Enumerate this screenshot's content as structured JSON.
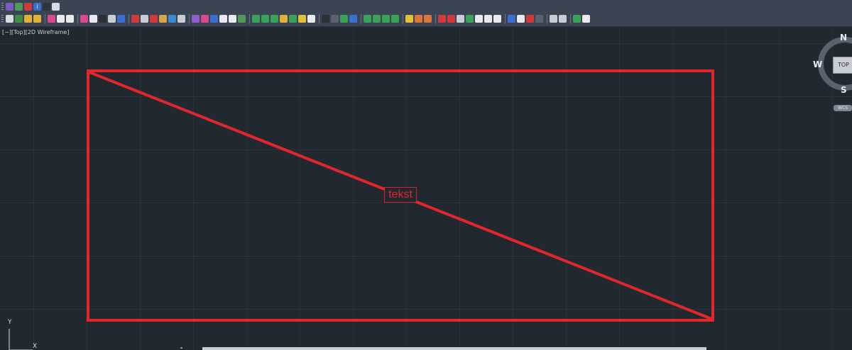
{
  "viewport": {
    "label": "[−][Top][2D Wireframe]",
    "drawing_color": "#e2262e",
    "text_object": "tekst"
  },
  "viewcube": {
    "north": "N",
    "west": "W",
    "south": "S",
    "face": "TOP",
    "wcs": "WCS"
  },
  "ucs": {
    "y": "Y",
    "x": "X"
  },
  "toolbar": {
    "row1": [
      {
        "name": "dimension-icon",
        "color": "#7c5cc4",
        "glyph": ""
      },
      {
        "name": "layer-image-icon",
        "color": "#4f9a5a",
        "glyph": ""
      },
      {
        "name": "shield-icon",
        "color": "#d03a3a",
        "glyph": ""
      },
      {
        "name": "info-icon",
        "color": "#3b6fd1",
        "glyph": "i"
      },
      {
        "name": "globe-icon",
        "color": "#2e3440",
        "glyph": ""
      },
      {
        "name": "edit-page-icon",
        "color": "#d7dbe2",
        "glyph": ""
      }
    ],
    "row2": [
      {
        "name": "layer-props-icon",
        "color": "#d7dbe2",
        "glyph": ""
      },
      {
        "name": "layer-state-icon",
        "color": "#3f8f45",
        "glyph": ""
      },
      {
        "name": "lock-icon",
        "color": "#e1b23a",
        "glyph": ""
      },
      {
        "name": "unlock-icon",
        "color": "#e1b23a",
        "glyph": ""
      },
      {
        "name": "sep",
        "color": "",
        "glyph": ""
      },
      {
        "name": "target-icon",
        "color": "#d94a8a",
        "glyph": ""
      },
      {
        "name": "insert-block-icon",
        "color": "#e8eaee",
        "glyph": ""
      },
      {
        "name": "text-height-icon",
        "color": "#e8eaee",
        "glyph": ""
      },
      {
        "name": "sep",
        "color": "",
        "glyph": ""
      },
      {
        "name": "properties-icon",
        "color": "#d94a8a",
        "glyph": ""
      },
      {
        "name": "page-icon",
        "color": "#e8eaee",
        "glyph": ""
      },
      {
        "name": "table-icon",
        "color": "#2b2f36",
        "glyph": ""
      },
      {
        "name": "match-props-icon",
        "color": "#c9ced6",
        "glyph": ""
      },
      {
        "name": "save-icon",
        "color": "#3b6fd1",
        "glyph": ""
      },
      {
        "name": "sep",
        "color": "",
        "glyph": ""
      },
      {
        "name": "print-icon",
        "color": "#d03a3a",
        "glyph": ""
      },
      {
        "name": "plot-icon",
        "color": "#c9ced6",
        "glyph": ""
      },
      {
        "name": "bar-icon",
        "color": "#d03a3a",
        "glyph": ""
      },
      {
        "name": "folder-icon",
        "color": "#d8a54a",
        "glyph": ""
      },
      {
        "name": "mountain-icon",
        "color": "#3a8ad1",
        "glyph": ""
      },
      {
        "name": "trash-icon",
        "color": "#c9ced6",
        "glyph": ""
      },
      {
        "name": "sep",
        "color": "",
        "glyph": ""
      },
      {
        "name": "orbit-icon",
        "color": "#8f5fd1",
        "glyph": ""
      },
      {
        "name": "layer-off-icon",
        "color": "#d94a8a",
        "glyph": ""
      },
      {
        "name": "frame-icon",
        "color": "#3b6fd1",
        "glyph": ""
      },
      {
        "name": "cloud-icon",
        "color": "#e8eaee",
        "glyph": ""
      },
      {
        "name": "cloud-up-icon",
        "color": "#e8eaee",
        "glyph": ""
      },
      {
        "name": "cloud-sync-icon",
        "color": "#4f9a5a",
        "glyph": ""
      },
      {
        "name": "sep",
        "color": "",
        "glyph": ""
      },
      {
        "name": "shape-green-icon",
        "color": "#3aa35a",
        "glyph": ""
      },
      {
        "name": "shape-green2-icon",
        "color": "#3aa35a",
        "glyph": ""
      },
      {
        "name": "shape-green3-icon",
        "color": "#3aa35a",
        "glyph": ""
      },
      {
        "name": "pencil-icon",
        "color": "#e1b23a",
        "glyph": ""
      },
      {
        "name": "snap-icon",
        "color": "#3aa35a",
        "glyph": ""
      },
      {
        "name": "shape-yellow-icon",
        "color": "#e1c03a",
        "glyph": ""
      },
      {
        "name": "shape-white-icon",
        "color": "#e8eaee",
        "glyph": ""
      },
      {
        "name": "sep",
        "color": "",
        "glyph": ""
      },
      {
        "name": "dark-square-icon",
        "color": "#2b2f36",
        "glyph": ""
      },
      {
        "name": "measure-icon",
        "color": "#5a6270",
        "glyph": ""
      },
      {
        "name": "diamond-icon",
        "color": "#3aa35a",
        "glyph": ""
      },
      {
        "name": "grid-icon",
        "color": "#3b6fd1",
        "glyph": ""
      },
      {
        "name": "sep",
        "color": "",
        "glyph": ""
      },
      {
        "name": "move-green-icon",
        "color": "#3aa35a",
        "glyph": ""
      },
      {
        "name": "copy-green-icon",
        "color": "#3aa35a",
        "glyph": ""
      },
      {
        "name": "rotate-green-icon",
        "color": "#3aa35a",
        "glyph": ""
      },
      {
        "name": "scale-green-icon",
        "color": "#3aa35a",
        "glyph": ""
      },
      {
        "name": "sep",
        "color": "",
        "glyph": ""
      },
      {
        "name": "sheet-yellow-icon",
        "color": "#e1c03a",
        "glyph": ""
      },
      {
        "name": "sheet-orange-icon",
        "color": "#d9773a",
        "glyph": ""
      },
      {
        "name": "sheet-mixed-icon",
        "color": "#d9773a",
        "glyph": ""
      },
      {
        "name": "sep",
        "color": "",
        "glyph": ""
      },
      {
        "name": "line-red-icon",
        "color": "#d03a3a",
        "glyph": ""
      },
      {
        "name": "line-red2-icon",
        "color": "#d03a3a",
        "glyph": ""
      },
      {
        "name": "join-icon",
        "color": "#c9ced6",
        "glyph": ""
      },
      {
        "name": "circle-green-icon",
        "color": "#3aa35a",
        "glyph": ""
      },
      {
        "name": "block-edit-icon",
        "color": "#e8eaee",
        "glyph": ""
      },
      {
        "name": "block-icon",
        "color": "#e8eaee",
        "glyph": ""
      },
      {
        "name": "block2-icon",
        "color": "#e8eaee",
        "glyph": ""
      },
      {
        "name": "sep",
        "color": "",
        "glyph": ""
      },
      {
        "name": "window-icon",
        "color": "#3b6fd1",
        "glyph": ""
      },
      {
        "name": "zoom-icon",
        "color": "#e8eaee",
        "glyph": ""
      },
      {
        "name": "flag-icon",
        "color": "#d03a3a",
        "glyph": ""
      },
      {
        "name": "shield-gray-icon",
        "color": "#5a6270",
        "glyph": ""
      },
      {
        "name": "sep",
        "color": "",
        "glyph": ""
      },
      {
        "name": "layout-icon",
        "color": "#c9ced6",
        "glyph": ""
      },
      {
        "name": "viewports-icon",
        "color": "#c9ced6",
        "glyph": ""
      },
      {
        "name": "sep",
        "color": "",
        "glyph": ""
      },
      {
        "name": "list-green-icon",
        "color": "#3aa35a",
        "glyph": ""
      },
      {
        "name": "check-icon",
        "color": "#e8eaee",
        "glyph": "✓"
      }
    ]
  }
}
